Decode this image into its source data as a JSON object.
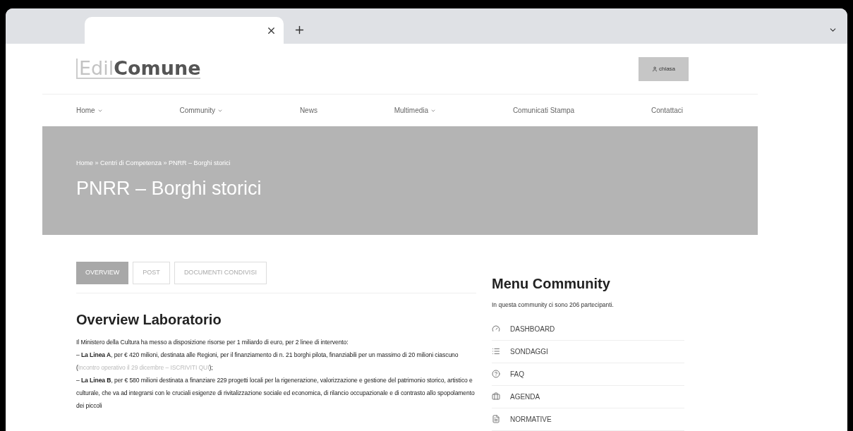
{
  "browser": {
    "tabs": [
      {
        "selected": true
      }
    ]
  },
  "header": {
    "logo_light": "Edil",
    "logo_bold": "Comune",
    "login_button": "chiasa"
  },
  "nav": [
    {
      "label": "Home",
      "dropdown": true
    },
    {
      "label": "Community",
      "dropdown": true
    },
    {
      "label": "News",
      "dropdown": false
    },
    {
      "label": "Multimedia",
      "dropdown": true
    },
    {
      "label": "Comunicati Stampa",
      "dropdown": false
    },
    {
      "label": "Contattaci",
      "dropdown": false
    }
  ],
  "banner": {
    "breadcrumb": "Home » Centri di Competenza » PNRR – Borghi storici",
    "title": "PNRR – Borghi storici"
  },
  "tabs": [
    {
      "label": "OVERVIEW",
      "selected": true
    },
    {
      "label": "POST",
      "selected": false
    },
    {
      "label": "DOCUMENTI CONDIVISI",
      "selected": false
    }
  ],
  "overview": {
    "heading": "Overview Laboratorio",
    "intro": "Il Ministero della Cultura ha messo a disposizione risorse per 1 miliardo di euro, per 2 linee di intervento:",
    "line_a": "– **La Linea A**, per € 420 milioni, destinata alle Regioni, per il finanziamento di n. 21 borghi pilota, finanziabili per un massimo di 20 milioni ciascuno (",
    "line_a_link": "Incontro operativo il 29 dicembre – ISCRIVITI QUI",
    "line_a_tail": ");",
    "line_b": "– **La Linea B**, per € 580 milioni destinata a finanziare 229 progetti locali per la rigenerazione, valorizzazione e gestione del patrimonio storico, artistico e culturale, che va ad integrarsi con le cruciali esigenze di rivitalizzazione sociale ed economica, di rilancio occupazionale e di contrasto allo spopolamento dei piccoli"
  },
  "sidebar": {
    "title": "Menu Community",
    "subtitle": "In questa community ci sono 206 partecipanti.",
    "items": [
      {
        "label": "DASHBOARD",
        "kind": "dashboard"
      },
      {
        "label": "SONDAGGI",
        "kind": "list"
      },
      {
        "label": "FAQ",
        "kind": "help"
      },
      {
        "label": "AGENDA",
        "kind": "briefcase"
      },
      {
        "label": "NORMATIVE",
        "kind": "document"
      }
    ]
  }
}
